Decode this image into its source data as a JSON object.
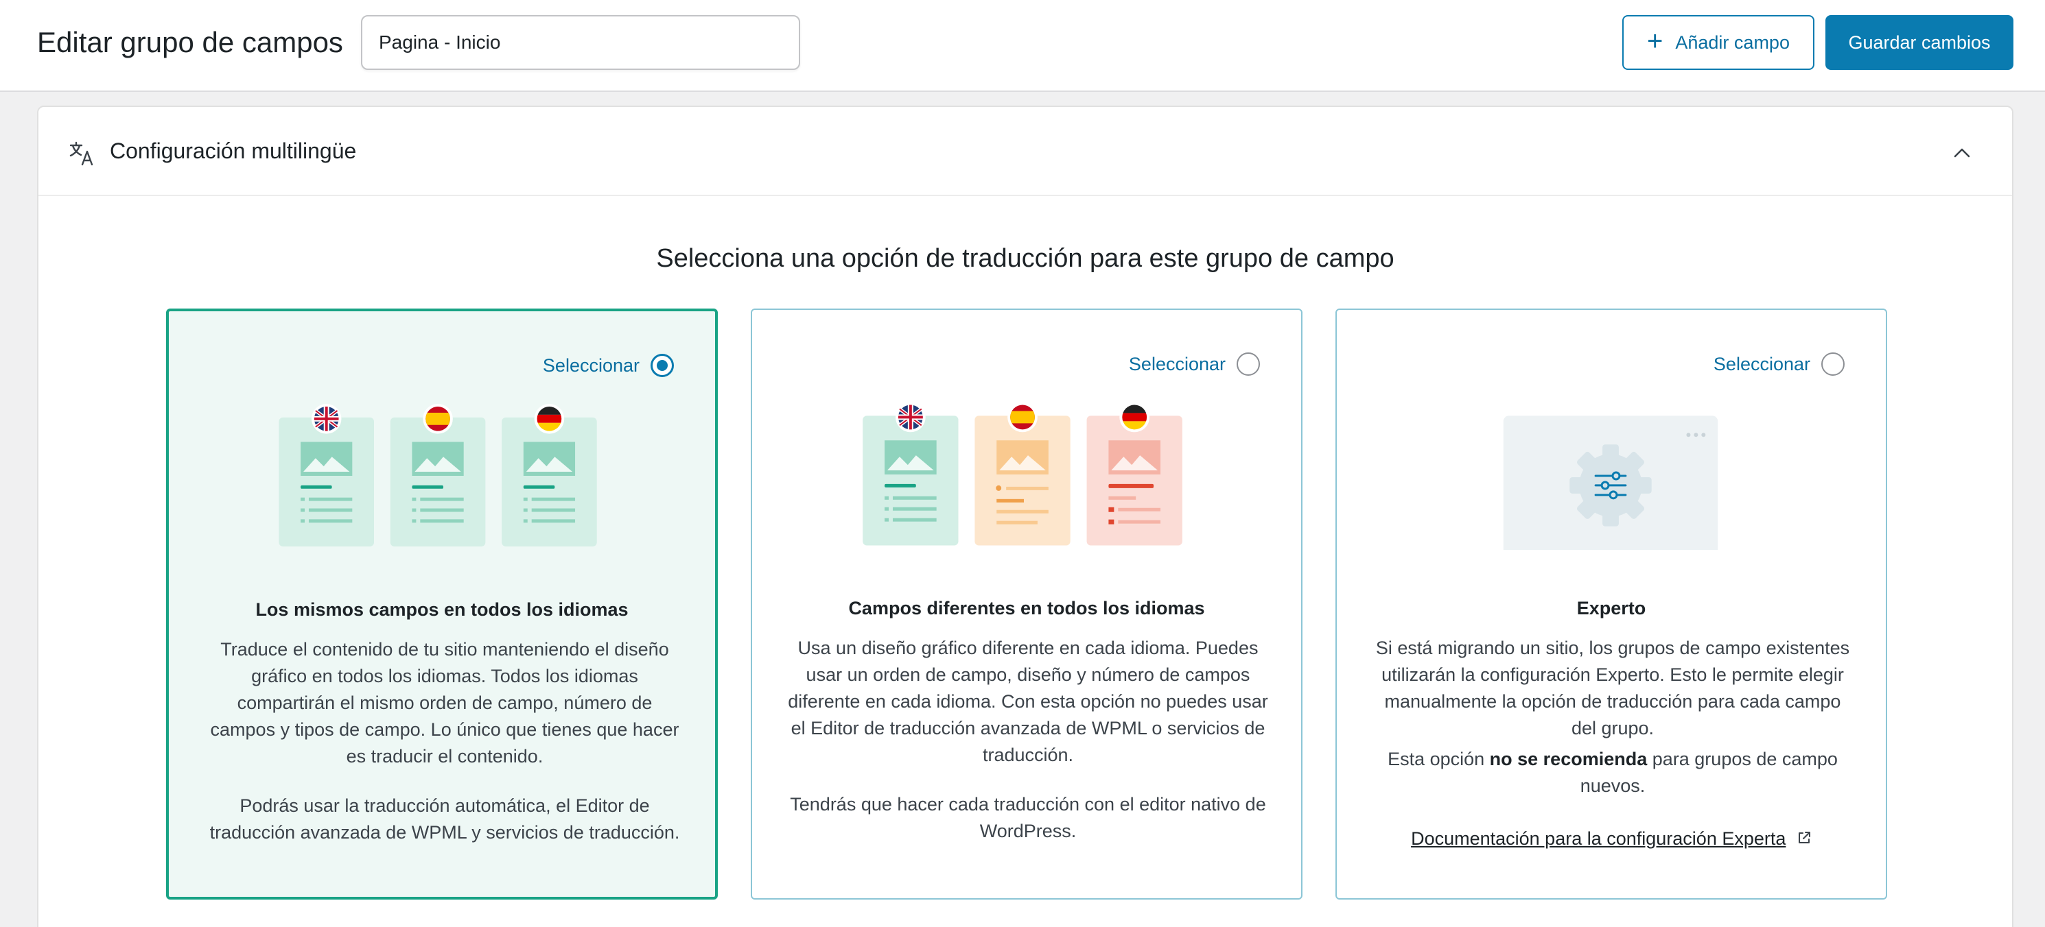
{
  "header": {
    "title": "Editar grupo de campos",
    "group_name_value": "Pagina - Inicio",
    "add_field_label": "Añadir campo",
    "save_label": "Guardar cambios"
  },
  "panel": {
    "title": "Configuración multilingüe",
    "heading": "Selecciona una opción de traducción para este grupo de campo"
  },
  "cards": [
    {
      "select_label": "Seleccionar",
      "selected": true,
      "title": "Los mismos campos en todos los idiomas",
      "p1": "Traduce el contenido de tu sitio manteniendo el diseño gráfico en todos los idiomas. Todos los idiomas compartirán el mismo orden de campo, número de campos y tipos de campo. Lo único que tienes que hacer es traducir el contenido.",
      "p2": "Podrás usar la traducción automática, el Editor de traducción avanzada de WPML y servicios de traducción."
    },
    {
      "select_label": "Seleccionar",
      "selected": false,
      "title": "Campos diferentes en todos los idiomas",
      "p1": "Usa un diseño gráfico diferente en cada idioma. Puedes usar un orden de campo, diseño y número de campos diferente en cada idioma. Con esta opción no puedes usar el Editor de traducción avanzada de WPML o servicios de traducción.",
      "p2": "Tendrás que hacer cada traducción con el editor nativo de WordPress."
    },
    {
      "select_label": "Seleccionar",
      "selected": false,
      "title": "Experto",
      "p1": "Si está migrando un sitio, los grupos de campo existentes utilizarán la configuración Experto. Esto le permite elegir manualmente la opción de traducción para cada campo del grupo.",
      "p2_pre": "Esta opción ",
      "p2_bold": "no se recomienda",
      "p2_post": " para grupos de campo nuevos.",
      "link": "Documentación para la configuración Experta"
    }
  ],
  "colors": {
    "accent": "#0a7bb0",
    "selected_border": "#19a385",
    "selected_bg": "#eef8f5",
    "card_border": "#8cc6d6"
  }
}
